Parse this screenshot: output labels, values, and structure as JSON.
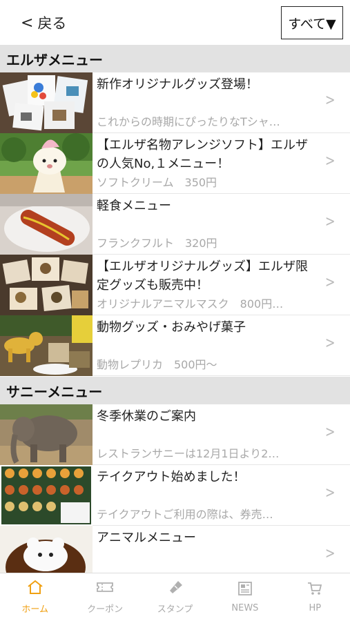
{
  "header": {
    "back_label": "戻る",
    "filter_label": "すべて▼"
  },
  "sections": [
    {
      "title": "エルザメニュー",
      "items": [
        {
          "title": "新作オリジナルグッズ登場！",
          "subtitle": "これからの時期にぴったりなTシャ…"
        },
        {
          "title": "【エルザ名物アレンジソフト】エルザの人気No,１メニュー！",
          "subtitle": "ソフトクリーム　350円"
        },
        {
          "title": "軽食メニュー",
          "subtitle": "フランクフルト　320円"
        },
        {
          "title": "【エルザオリジナルグッズ】エルザ限定グッズも販売中！",
          "subtitle": "オリジナルアニマルマスク　800円…"
        },
        {
          "title": "動物グッズ・おみやげ菓子",
          "subtitle": "動物レプリカ　500円〜"
        }
      ]
    },
    {
      "title": "サニーメニュー",
      "items": [
        {
          "title": "冬季休業のご案内",
          "subtitle": "レストランサニーは12月1日より2…"
        },
        {
          "title": "テイクアウト始めました！",
          "subtitle": "テイクアウトご利用の際は、券売…"
        },
        {
          "title": "アニマルメニュー",
          "subtitle": ""
        }
      ]
    }
  ],
  "tabbar": [
    {
      "label": "ホーム",
      "icon": "home-icon",
      "active": true
    },
    {
      "label": "クーポン",
      "icon": "ticket-icon",
      "active": false
    },
    {
      "label": "スタンプ",
      "icon": "stamp-icon",
      "active": false
    },
    {
      "label": "NEWS",
      "icon": "news-icon",
      "active": false
    },
    {
      "label": "HP",
      "icon": "cart-icon",
      "active": false
    }
  ],
  "colors": {
    "accent": "#f0a012",
    "section_bg": "#e2e2e2",
    "muted_text": "#a8a8a8"
  }
}
